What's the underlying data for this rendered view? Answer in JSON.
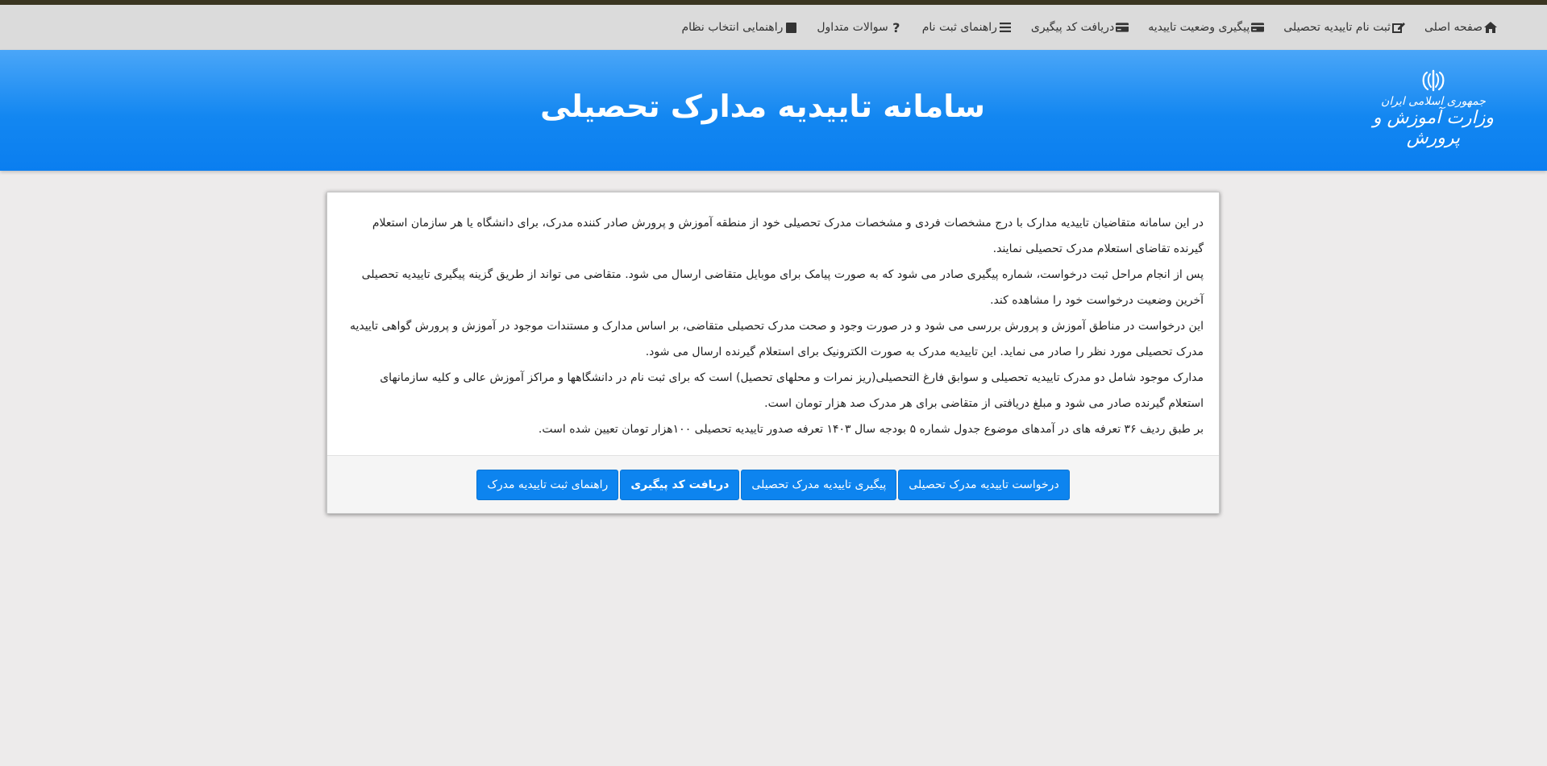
{
  "colors": {
    "top_line": "#3a3521",
    "navbar_bg": "#dbdbdb",
    "banner_top": "#4aa6f8",
    "banner_bottom": "#0a7ef0",
    "button_bg": "#0d84ef",
    "page_bg": "#edebeb"
  },
  "nav": {
    "items": [
      {
        "label": "صفحه اصلی",
        "icon": "home-icon"
      },
      {
        "label": "ثبت نام تاییدیه تحصیلی",
        "icon": "edit-icon"
      },
      {
        "label": "پیگیری وضعیت تاییدیه",
        "icon": "credit-card-icon"
      },
      {
        "label": "دریافت کد پیگیری",
        "icon": "credit-card-icon"
      },
      {
        "label": "راهنمای ثبت نام",
        "icon": "list-icon"
      },
      {
        "label": "سوالات متداول",
        "icon": "question-icon"
      },
      {
        "label": "راهنمایی انتخاب نظام",
        "icon": "square-icon"
      }
    ]
  },
  "header": {
    "title": "سامانه تاییدیه مدارک تحصیلی",
    "logo_line1": "جمهوری اسلامی ایران",
    "logo_line2": "وزارت آموزش و پرورش"
  },
  "panel": {
    "paragraphs": [
      "در این سامانه متقاضیان تاییدیه مدارک با درج مشخصات فردی و مشخصات مدرک تحصیلی خود از منطقه آموزش و پرورش صادر کننده مدرک، برای دانشگاه یا هر سازمان استعلام گیرنده تقاضای استعلام مدرک تحصیلی نمایند.",
      "پس از انجام مراحل ثبت درخواست، شماره پیگیری صادر می شود که به صورت پیامک برای موبایل متقاضی ارسال می شود. متقاضی می تواند از طریق گزینه پیگیری تاییدیه تحصیلی آخرین وضعیت درخواست خود را مشاهده کند.",
      "این درخواست در مناطق آموزش و پرورش بررسی می شود و در صورت وجود و صحت مدرک تحصیلی متقاضی، بر اساس مدارک و مستندات موجود در آموزش و پرورش گواهی تاییدیه مدرک تحصیلی مورد نظر را صادر می نماید. این تاییدیه مدرک به صورت الکترونیک برای استعلام گیرنده ارسال می شود.",
      "مدارک موجود شامل دو مدرک تاییدیه تحصیلی و سوابق فارغ التحصیلی(ریز نمرات و محلهای تحصیل) است که برای ثبت نام در دانشگاهها و مراکز آموزش عالی و کلیه سازمانهای استعلام گیرنده صادر می شود و مبلغ دریافتی از متقاضی برای هر مدرک صد هزار تومان است.",
      "بر طبق ردیف ۳۶ تعرفه های در آمدهای موضوع جدول شماره ۵ بودجه سال ۱۴۰۳ تعرفه صدور تاییدیه تحصیلی ۱۰۰هزار تومان تعیین شده است."
    ],
    "buttons": [
      {
        "label": "درخواست تاییدیه مدرک تحصیلی",
        "bold": false
      },
      {
        "label": "پیگیری تاییدیه مدرک تحصیلی",
        "bold": false
      },
      {
        "label": "دریافت کد پیگیری",
        "bold": true
      },
      {
        "label": "راهنمای ثبت تاییدیه مدرک",
        "bold": false
      }
    ]
  }
}
